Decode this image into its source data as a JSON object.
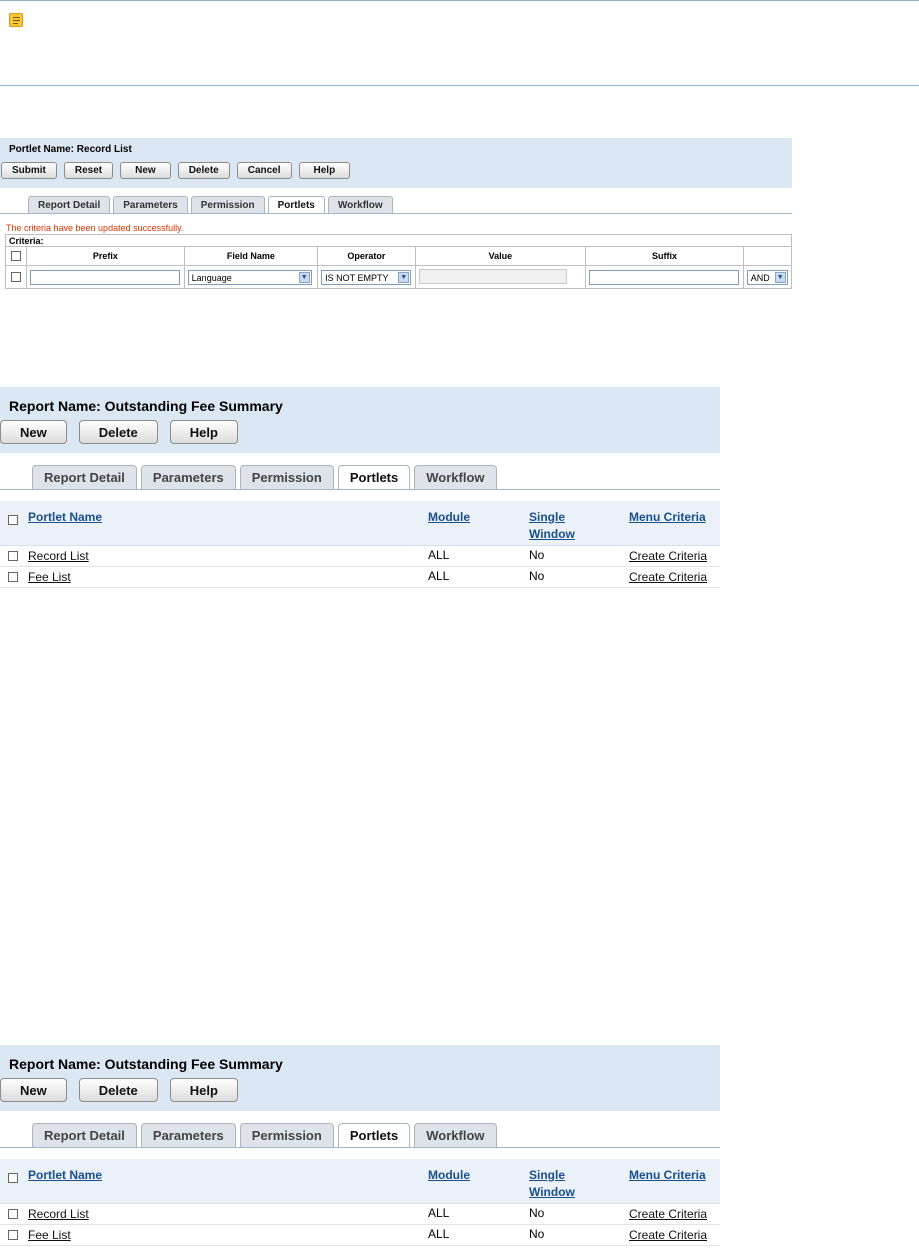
{
  "panel1": {
    "title": "Portlet Name: Record List",
    "buttons": [
      "Submit",
      "Reset",
      "New",
      "Delete",
      "Cancel",
      "Help"
    ],
    "tabs": [
      "Report Detail",
      "Parameters",
      "Permission",
      "Portlets",
      "Workflow"
    ],
    "active_tab": "Portlets",
    "message": "The criteria have been updated successfully.",
    "criteria_label": "Criteria:",
    "columns": [
      "Prefix",
      "Field Name",
      "Operator",
      "Value",
      "Suffix"
    ],
    "row": {
      "prefix": "",
      "field_name": "Language",
      "operator": "IS NOT EMPTY",
      "value": "",
      "suffix": "",
      "conjunction": "AND"
    }
  },
  "panel2": {
    "title": "Report Name: Outstanding Fee Summary",
    "buttons": [
      "New",
      "Delete",
      "Help"
    ],
    "tabs": [
      "Report Detail",
      "Parameters",
      "Permission",
      "Portlets",
      "Workflow"
    ],
    "active_tab": "Portlets",
    "columns": [
      "Portlet Name",
      "Module",
      "Single",
      "Window",
      "Menu Criteria"
    ],
    "rows": [
      {
        "name": "Record List",
        "module": "ALL",
        "single": "No",
        "menu": "Create Criteria"
      },
      {
        "name": "Fee List",
        "module": "ALL",
        "single": "No",
        "menu": "Create Criteria"
      }
    ]
  },
  "panel3": {
    "title": "Report Name: Outstanding Fee Summary",
    "buttons": [
      "New",
      "Delete",
      "Help"
    ],
    "tabs": [
      "Report Detail",
      "Parameters",
      "Permission",
      "Portlets",
      "Workflow"
    ],
    "active_tab": "Portlets",
    "columns": [
      "Portlet Name",
      "Module",
      "Single",
      "Window",
      "Menu Criteria"
    ],
    "rows": [
      {
        "name": "Record List",
        "module": "ALL",
        "single": "No",
        "menu": "Create Criteria"
      },
      {
        "name": "Fee List",
        "module": "ALL",
        "single": "No",
        "menu": "Create Criteria"
      }
    ]
  }
}
